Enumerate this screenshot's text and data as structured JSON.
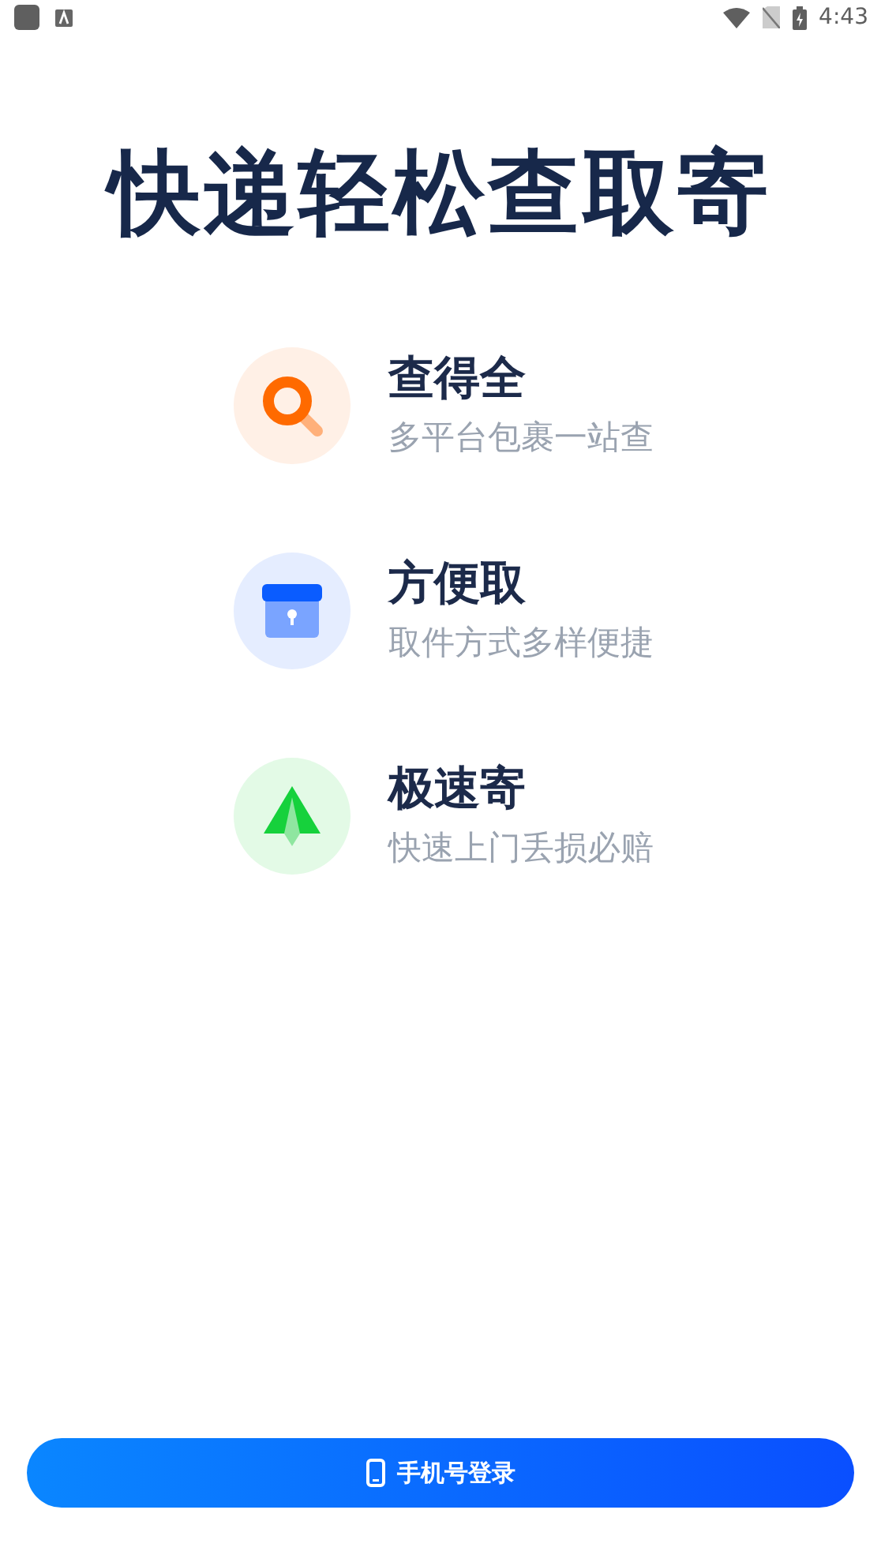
{
  "status_bar": {
    "time": "4:43"
  },
  "headline": "快递轻松查取寄",
  "features": [
    {
      "kind": "search",
      "title": "查得全",
      "subtitle": "多平台包裹一站查"
    },
    {
      "kind": "box",
      "title": "方便取",
      "subtitle": "取件方式多样便捷"
    },
    {
      "kind": "plane",
      "title": "极速寄",
      "subtitle": "快速上门丢损必赔"
    }
  ],
  "login_button": {
    "label": "手机号登录"
  }
}
